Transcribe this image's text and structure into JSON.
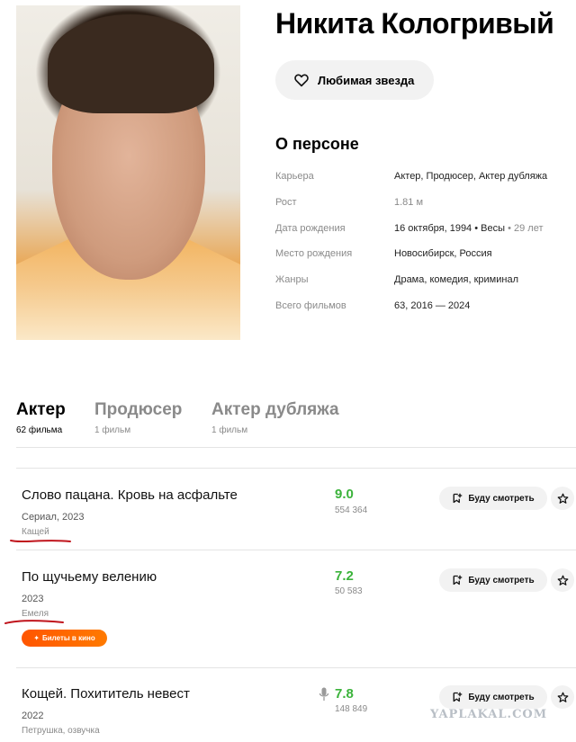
{
  "person": {
    "name": "Никита Кологривый",
    "favorite_label": "Любимая звезда"
  },
  "about": {
    "title": "О персоне",
    "rows": [
      {
        "key": "Карьера",
        "value": "Актер, Продюсер, Актер дубляжа"
      },
      {
        "key": "Рост",
        "value": "1.81 м"
      },
      {
        "key": "Дата рождения",
        "value": "16 октября, 1994",
        "extra1": " • Весы",
        "extra2": " • 29 лет"
      },
      {
        "key": "Место рождения",
        "value": "Новосибирск, Россия"
      },
      {
        "key": "Жанры",
        "value": "Драма, комедия, криминал"
      },
      {
        "key": "Всего фильмов",
        "value": "63, 2016 — 2024"
      }
    ]
  },
  "tabs": [
    {
      "label": "Актер",
      "count": "62 фильма"
    },
    {
      "label": "Продюсер",
      "count": "1 фильм"
    },
    {
      "label": "Актер дубляжа",
      "count": "1 фильм"
    }
  ],
  "films": [
    {
      "title": "Слово пацана. Кровь на асфальте",
      "meta": "Сериал, 2023",
      "role": "Кащей",
      "rating": "9.0",
      "votes": "554 364",
      "watch_label": "Буду смотреть"
    },
    {
      "title": "По щучьему велению",
      "meta": "2023",
      "role": "Емеля",
      "rating": "7.2",
      "votes": "50 583",
      "watch_label": "Буду смотреть",
      "tickets_label": "Билеты в кино"
    },
    {
      "title": "Кощей. Похититель невест",
      "meta": "2022",
      "role": "Петрушка, озвучка",
      "rating": "7.8",
      "votes": "148 849",
      "watch_label": "Буду смотреть"
    }
  ],
  "watermark": "YAPLAKAL.COM",
  "colors": {
    "rating_green": "#3bb33b",
    "tickets_orange": "#ff6a00",
    "annotation_red": "#c0141c"
  }
}
